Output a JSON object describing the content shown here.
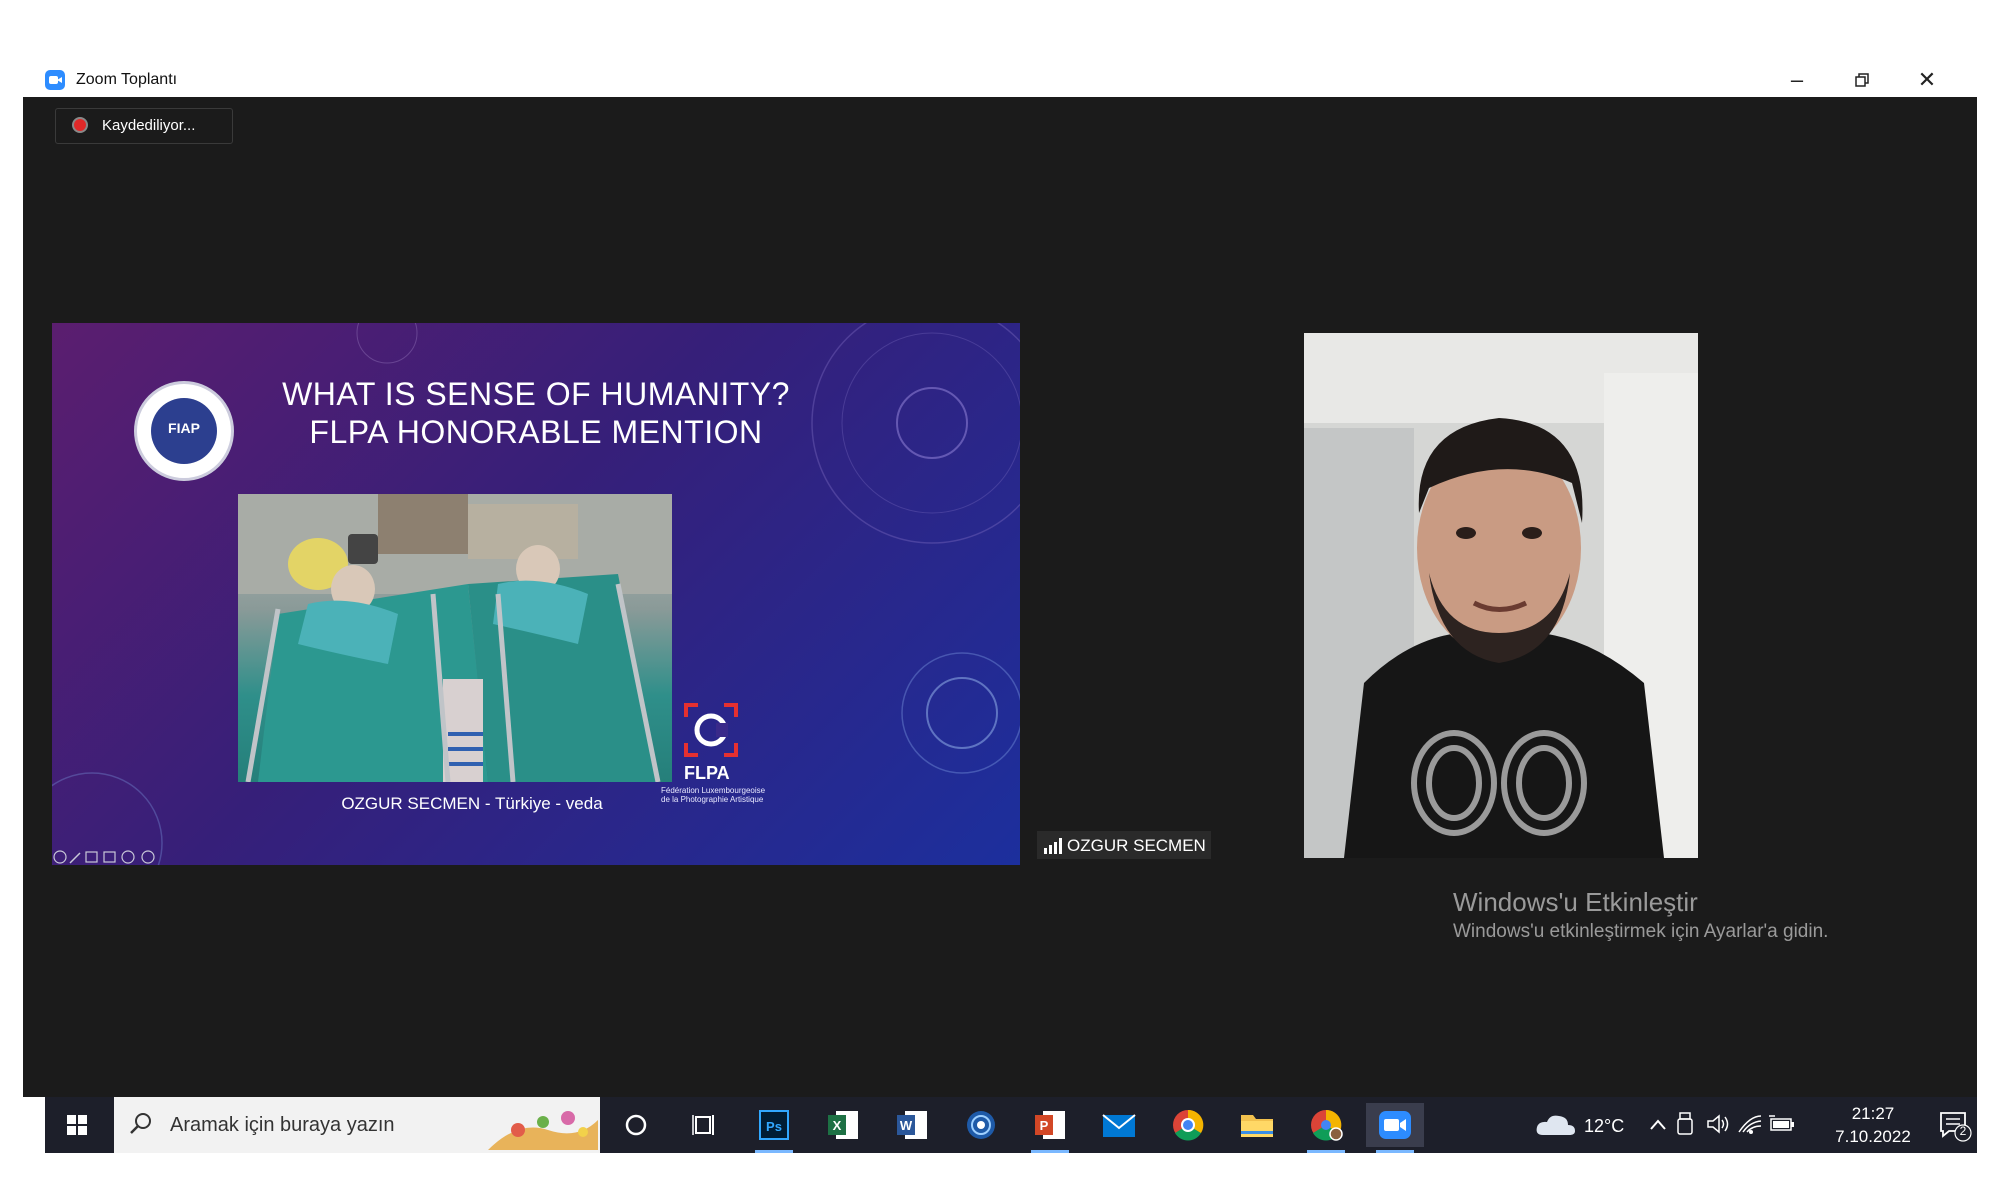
{
  "window": {
    "title": "Zoom Toplantı"
  },
  "meeting": {
    "recording_label": "Kaydediliyor..."
  },
  "slide": {
    "title_line1": "WHAT IS SENSE OF HUMANITY?",
    "title_line2": "FLPA HONORABLE MENTION",
    "logo_text": "FIAP",
    "photo_caption": "OZGUR SECMEN - Türkiye - veda",
    "flpa_name": "FLPA",
    "flpa_sub": "Fédération Luxembourgeoise de la Photographie Artistique"
  },
  "participant": {
    "name": "OZGUR SECMEN"
  },
  "activation": {
    "title": "Windows'u Etkinleştir",
    "message": "Windows'u etkinleştirmek için Ayarlar'a gidin."
  },
  "taskbar": {
    "search_placeholder": "Aramak için buraya yazın",
    "apps": [
      "cortana-icon",
      "task-view-icon",
      "photoshop-icon",
      "excel-icon",
      "word-icon",
      "network-app-icon",
      "powerpoint-icon",
      "mail-icon",
      "chrome-icon",
      "file-explorer-icon",
      "chrome-profile-icon",
      "zoom-icon"
    ],
    "weather_temp": "12°C",
    "time": "21:27",
    "date": "7.10.2022",
    "notification_count": "2"
  },
  "colors": {
    "zoom_blue": "#2d8cff",
    "meeting_bg": "#1b1b1b",
    "taskbar_bg": "#1d1f2a",
    "recording_red": "#e02828"
  }
}
